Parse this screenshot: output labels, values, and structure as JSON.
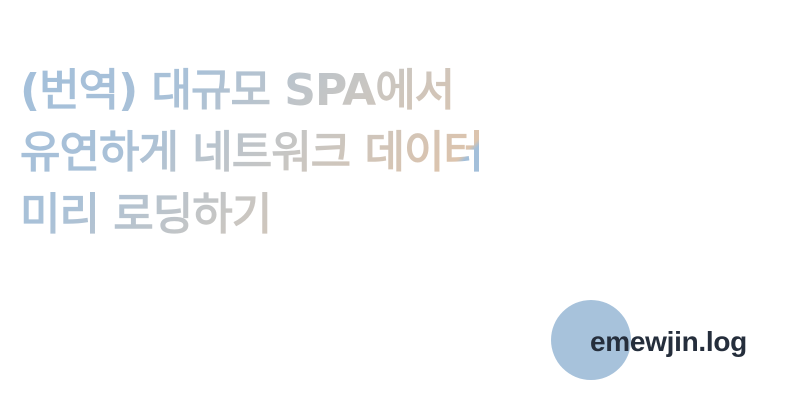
{
  "title": {
    "lines": [
      "(번역) 대규모 SPA에서",
      "유연하게 네트워크 데이터",
      "미리 로딩하기"
    ]
  },
  "brand": {
    "name": "emewjin.log"
  },
  "colors": {
    "title_blue": "#a3bfda",
    "title_beige": "#dcc4ad",
    "circle": "#a7c2db",
    "brand_text": "#252e3c"
  }
}
